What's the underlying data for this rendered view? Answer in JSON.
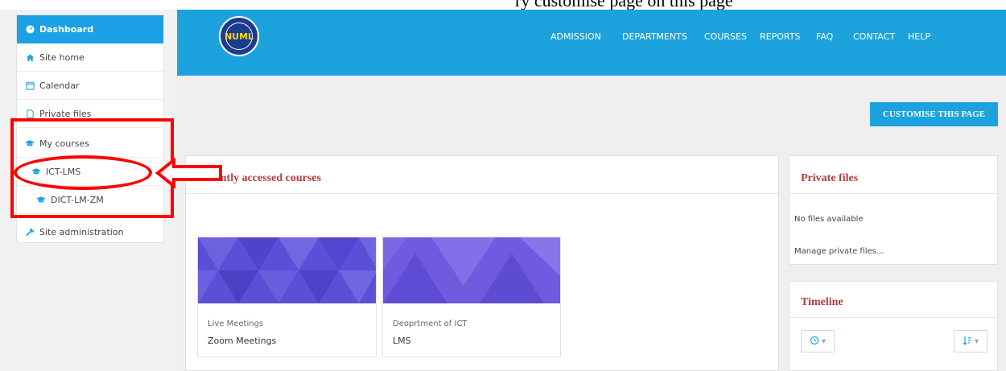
{
  "caption": {
    "text": "ry customise page on this page"
  },
  "sidebar": {
    "items": [
      {
        "label": "Dashboard",
        "icon": "dashboard-icon"
      },
      {
        "label": "Site home",
        "icon": "home-icon"
      },
      {
        "label": "Calendar",
        "icon": "calendar-icon"
      },
      {
        "label": "Private files",
        "icon": "file-icon"
      },
      {
        "label": "My courses",
        "icon": "graduation-cap-icon"
      },
      {
        "label": "ICT-LMS",
        "icon": "graduation-cap-icon"
      },
      {
        "label": "DICT-LM-ZM",
        "icon": "graduation-cap-icon"
      },
      {
        "label": "Site administration",
        "icon": "wrench-icon"
      }
    ]
  },
  "header": {
    "logo_text": "NUML",
    "nav": [
      "ADMISSION",
      "DEPARTMENTS",
      "COURSES",
      "REPORTS",
      "FAQ",
      "CONTACT",
      "HELP"
    ]
  },
  "main": {
    "customise_label": "CUSTOMISE THIS PAGE",
    "recent": {
      "title": "Recently accessed courses",
      "courses": [
        {
          "category": "Live Meetings",
          "name": "Zoom Meetings"
        },
        {
          "category": "Deoprtment of ICT",
          "name": "LMS"
        }
      ]
    },
    "private_files": {
      "title": "Private files",
      "empty": "No files available",
      "manage": "Manage private files..."
    },
    "timeline": {
      "title": "Timeline"
    }
  },
  "colors": {
    "accent": "#1ca3dd",
    "title_red": "#b73a3a",
    "annotation": "#ff0000"
  }
}
